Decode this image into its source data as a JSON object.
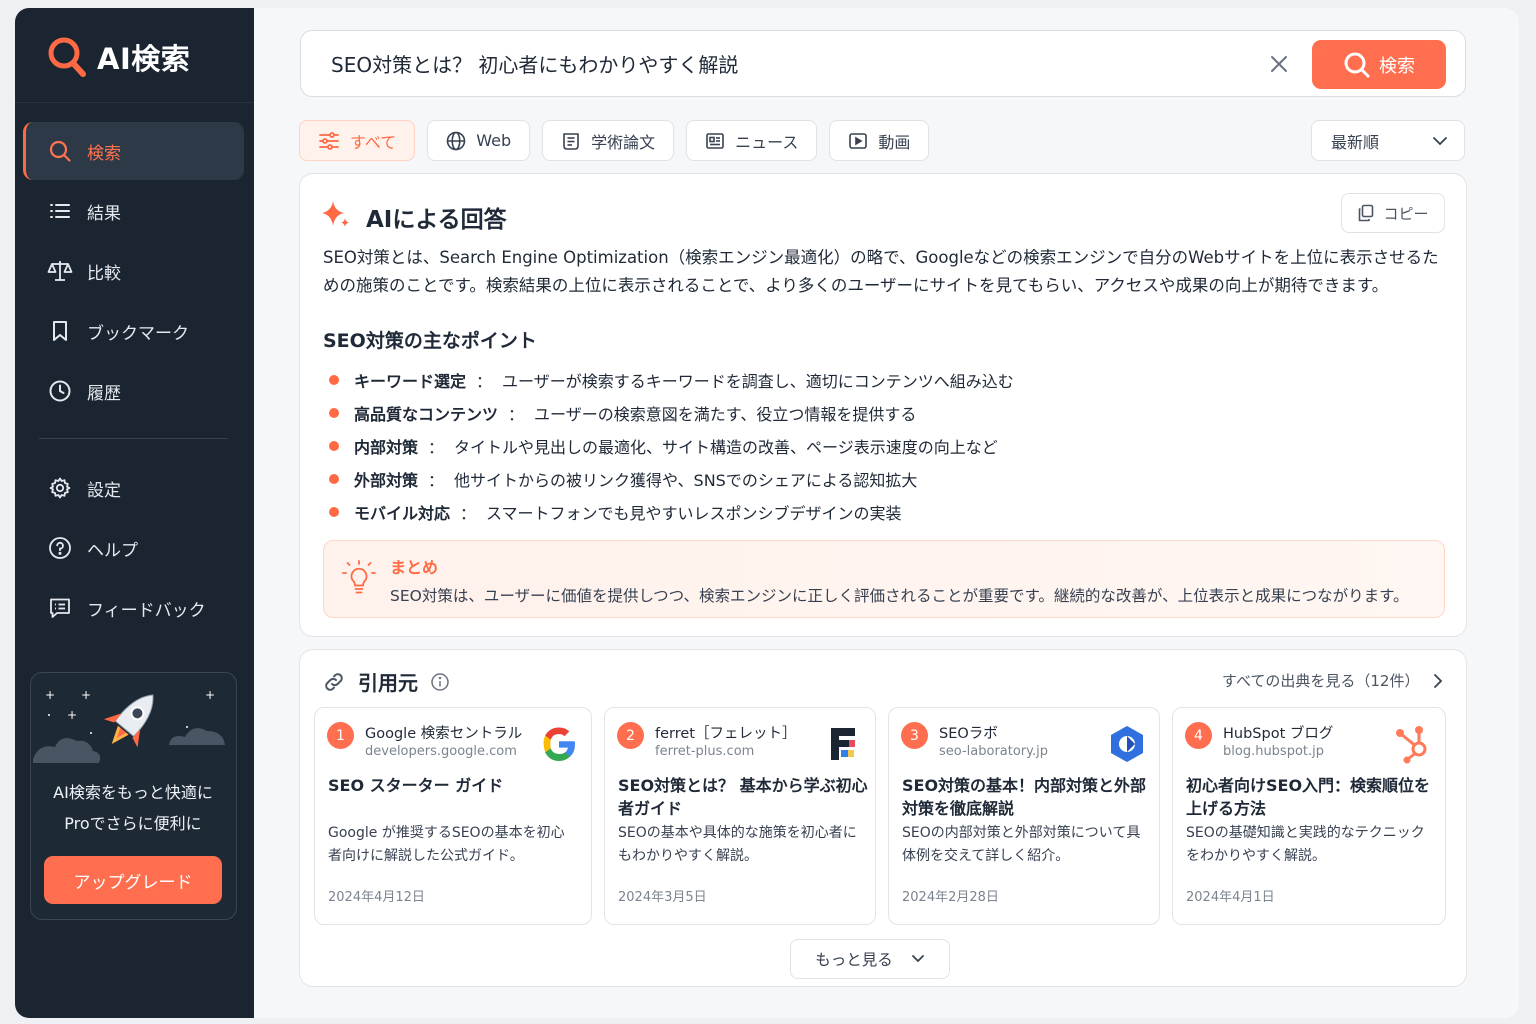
{
  "app": {
    "logo_text": "AI検索"
  },
  "sidebar": {
    "items": [
      {
        "label": "検索",
        "icon": "search-icon"
      },
      {
        "label": "結果",
        "icon": "list-icon"
      },
      {
        "label": "比較",
        "icon": "scale-icon"
      },
      {
        "label": "ブックマーク",
        "icon": "bookmark-icon"
      },
      {
        "label": "履歴",
        "icon": "clock-icon"
      }
    ],
    "items2": [
      {
        "label": "設定",
        "icon": "gear-icon"
      },
      {
        "label": "ヘルプ",
        "icon": "help-icon"
      },
      {
        "label": "フィードバック",
        "icon": "feedback-icon"
      }
    ],
    "promo": {
      "line1": "AI検索をもっと快適に",
      "line2": "Proでさらに便利に",
      "button": "アップグレード"
    }
  },
  "search": {
    "value": "SEO対策とは？ 初心者にもわかりやすく解説",
    "button": "検索"
  },
  "filters": [
    {
      "label": "すべて",
      "icon": "sliders-icon",
      "active": true
    },
    {
      "label": "Web",
      "icon": "globe-icon"
    },
    {
      "label": "学術論文",
      "icon": "paper-icon"
    },
    {
      "label": "ニュース",
      "icon": "news-icon"
    },
    {
      "label": "動画",
      "icon": "video-icon"
    }
  ],
  "sort": {
    "selected": "最新順"
  },
  "answer": {
    "title": "AIによる回答",
    "copy": "コピー",
    "body": "SEO対策とは、Search Engine Optimization（検索エンジン最適化）の略で、Googleなどの検索エンジンで自分のWebサイトを上位に表示させるための施策のことです。検索結果の上位に表示されることで、より多くのユーザーにサイトを見てもらい、アクセスや成果の向上が期待できます。",
    "points_title": "SEO対策の主なポイント",
    "points": [
      {
        "term": "キーワード選定",
        "desc": "ユーザーが検索するキーワードを調査し、適切にコンテンツへ組み込む"
      },
      {
        "term": "高品質なコンテンツ",
        "desc": "ユーザーの検索意図を満たす、役立つ情報を提供する"
      },
      {
        "term": "内部対策",
        "desc": "タイトルや見出しの最適化、サイト構造の改善、ページ表示速度の向上など"
      },
      {
        "term": "外部対策",
        "desc": "他サイトからの被リンク獲得や、SNSでのシェアによる認知拡大"
      },
      {
        "term": "モバイル対応",
        "desc": "スマートフォンでも見やすいレスポンシブデザインの実装"
      }
    ],
    "summary_title": "まとめ",
    "summary_text": "SEO対策は、ユーザーに価値を提供しつつ、検索エンジンに正しく評価されることが重要です。継続的な改善が、上位表示と成果につながります。"
  },
  "sources": {
    "title": "引用元",
    "see_all": "すべての出典を見る（12件）",
    "more": "もっと見る",
    "cards": [
      {
        "num": "1",
        "name": "Google 検索セントラル",
        "domain": "developers.google.com",
        "logo": "google-logo-icon",
        "title": "SEO スターター ガイド",
        "desc": "Google が推奨するSEOの基本を初心者向けに解説した公式ガイド。",
        "date": "2024年4月12日"
      },
      {
        "num": "2",
        "name": "ferret［フェレット］",
        "domain": "ferret-plus.com",
        "logo": "ferret-logo-icon",
        "title": "SEO対策とは？ 基本から学ぶ初心者ガイド",
        "desc": "SEOの基本や具体的な施策を初心者にもわかりやすく解説。",
        "date": "2024年3月5日"
      },
      {
        "num": "3",
        "name": "SEOラボ",
        "domain": "seo-laboratory.jp",
        "logo": "seolab-logo-icon",
        "title": "SEO対策の基本！内部対策と外部対策を徹底解説",
        "desc": "SEOの内部対策と外部対策について具体例を交えて詳しく紹介。",
        "date": "2024年2月28日"
      },
      {
        "num": "4",
        "name": "HubSpot ブログ",
        "domain": "blog.hubspot.jp",
        "logo": "hubspot-logo-icon",
        "title": "初心者向けSEO入門：検索順位を上げる方法",
        "desc": "SEOの基礎知識と実践的なテクニックをわかりやすく解説。",
        "date": "2024年4月1日"
      }
    ]
  },
  "colors": {
    "accent": "#ff6f4f",
    "sidebar": "#1b2531"
  }
}
